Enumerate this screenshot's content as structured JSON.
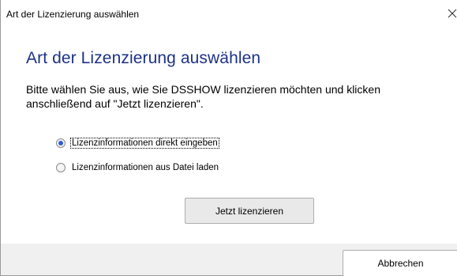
{
  "window": {
    "title": "Art der Lizenzierung auswählen",
    "close_glyph": "✕",
    "close_icon": "close-icon"
  },
  "main": {
    "heading": "Art der Lizenzierung auswählen",
    "description": "Bitte wählen Sie aus, wie Sie DSSHOW lizenzieren möchten und klicken anschließend auf \"Jetzt lizenzieren\".",
    "options": [
      {
        "label": "Lizenzinformationen direkt eingeben",
        "selected": true
      },
      {
        "label": "Lizenzinformationen aus Datei laden",
        "selected": false
      }
    ],
    "license_button_label": "Jetzt lizenzieren"
  },
  "footer": {
    "cancel_label": "Abbrechen"
  },
  "colors": {
    "heading": "#1e3287",
    "radio_dot": "#2e5fd0",
    "footer_bg": "#f0f0f0",
    "button_bg": "#e9e9e9"
  }
}
